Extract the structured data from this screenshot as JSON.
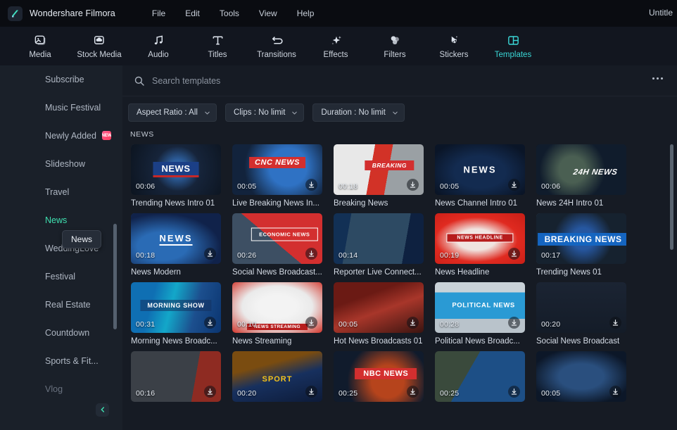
{
  "app": {
    "brand": "Wondershare Filmora",
    "logo_icon": "filmora-logo-icon",
    "document_title": "Untitle",
    "accent_color": "#3ad6d6",
    "active_category_color": "#3fe0b0"
  },
  "menubar": {
    "items": [
      {
        "label": "File",
        "name": "menu-file"
      },
      {
        "label": "Edit",
        "name": "menu-edit"
      },
      {
        "label": "Tools",
        "name": "menu-tools"
      },
      {
        "label": "View",
        "name": "menu-view"
      },
      {
        "label": "Help",
        "name": "menu-help"
      }
    ]
  },
  "tooltabs": {
    "items": [
      {
        "label": "Media",
        "icon": "media-image-icon",
        "active": false
      },
      {
        "label": "Stock Media",
        "icon": "stock-media-cloud-icon",
        "active": false
      },
      {
        "label": "Audio",
        "icon": "audio-note-icon",
        "active": false
      },
      {
        "label": "Titles",
        "icon": "titles-text-icon",
        "active": false
      },
      {
        "label": "Transitions",
        "icon": "transitions-arrow-icon",
        "active": false
      },
      {
        "label": "Effects",
        "icon": "effects-sparkle-icon",
        "active": false
      },
      {
        "label": "Filters",
        "icon": "filters-circles-icon",
        "active": false
      },
      {
        "label": "Stickers",
        "icon": "stickers-cursor-icon",
        "active": false
      },
      {
        "label": "Templates",
        "icon": "templates-layout-icon",
        "active": true
      }
    ]
  },
  "sidebar": {
    "items": [
      {
        "label": "Subscribe",
        "state": "normal",
        "badge": null
      },
      {
        "label": "Music Festival",
        "state": "normal",
        "badge": null
      },
      {
        "label": "Newly Added",
        "state": "normal",
        "badge": "NEW"
      },
      {
        "label": "Slideshow",
        "state": "normal",
        "badge": null
      },
      {
        "label": "Travel",
        "state": "normal",
        "badge": null
      },
      {
        "label": "News",
        "state": "active",
        "badge": null
      },
      {
        "label": "WeddingLove",
        "state": "normal",
        "badge": null
      },
      {
        "label": "Festival",
        "state": "normal",
        "badge": null
      },
      {
        "label": "Real Estate",
        "state": "normal",
        "badge": null
      },
      {
        "label": "Countdown",
        "state": "normal",
        "badge": null
      },
      {
        "label": "Sports & Fit...",
        "state": "normal",
        "badge": null
      },
      {
        "label": "Vlog",
        "state": "dim",
        "badge": null
      }
    ],
    "tooltip": "News",
    "collapse_icon": "chevron-left-icon"
  },
  "search": {
    "placeholder": "Search templates",
    "value": "",
    "icon": "search-icon",
    "more_icon": "more-options-icon"
  },
  "filters": {
    "chips": [
      {
        "label": "Aspect Ratio : All",
        "name": "filter-aspect-ratio"
      },
      {
        "label": "Clips : No limit",
        "name": "filter-clips"
      },
      {
        "label": "Duration : No limit",
        "name": "filter-duration"
      }
    ],
    "chevron_icon": "chevron-down-icon"
  },
  "results": {
    "section_label": "NEWS",
    "download_icon": "download-icon",
    "templates": [
      {
        "title": "Trending News Intro 01",
        "duration": "00:06",
        "art": "a1",
        "overlay": "NEWS",
        "show_dl": false
      },
      {
        "title": "Live Breaking News In...",
        "duration": "00:05",
        "art": "a2",
        "overlay": "CNC NEWS",
        "show_dl": true
      },
      {
        "title": "Breaking News",
        "duration": "00:18",
        "art": "a3",
        "overlay": "BREAKING",
        "show_dl": true
      },
      {
        "title": "News Channel Intro 01",
        "duration": "00:05",
        "art": "a4",
        "overlay": "NEWS",
        "show_dl": true
      },
      {
        "title": "News 24H Intro 01",
        "duration": "00:06",
        "art": "a5",
        "overlay": "24H NEWS",
        "show_dl": false
      },
      {
        "title": "News Modern",
        "duration": "00:18",
        "art": "b1",
        "overlay": "NEWS",
        "show_dl": true
      },
      {
        "title": "Social News Broadcast...",
        "duration": "00:26",
        "art": "b2",
        "overlay": "ECONOMIC NEWS",
        "show_dl": true
      },
      {
        "title": "Reporter Live Connect...",
        "duration": "00:14",
        "art": "b3",
        "overlay": "",
        "show_dl": false
      },
      {
        "title": "News Headline",
        "duration": "00:19",
        "art": "b4",
        "overlay": "NEWS HEADLINE",
        "show_dl": true
      },
      {
        "title": "Trending News 01",
        "duration": "00:17",
        "art": "b5",
        "overlay": "BREAKING NEWS",
        "show_dl": false
      },
      {
        "title": "Morning News Broadc...",
        "duration": "00:31",
        "art": "c1",
        "overlay": "MORNING SHOW",
        "show_dl": true
      },
      {
        "title": "News Streaming",
        "duration": "00:10",
        "art": "c2",
        "overlay": "NEWS STREAMING",
        "show_dl": true
      },
      {
        "title": "Hot News Broadcasts 01",
        "duration": "00:05",
        "art": "c3",
        "overlay": "",
        "show_dl": true
      },
      {
        "title": "Political News Broadc...",
        "duration": "00:28",
        "art": "c4",
        "overlay": "POLITICAL NEWS",
        "show_dl": true
      },
      {
        "title": "Social News Broadcast",
        "duration": "00:20",
        "art": "c5",
        "overlay": "",
        "show_dl": true
      },
      {
        "title": "",
        "duration": "00:16",
        "art": "d1",
        "overlay": "",
        "show_dl": true
      },
      {
        "title": "",
        "duration": "00:20",
        "art": "d2",
        "overlay": "SPORT",
        "show_dl": true
      },
      {
        "title": "",
        "duration": "00:25",
        "art": "d3",
        "overlay": "NBC NEWS",
        "show_dl": true
      },
      {
        "title": "",
        "duration": "00:25",
        "art": "d4",
        "overlay": "",
        "show_dl": true
      },
      {
        "title": "",
        "duration": "00:05",
        "art": "d5",
        "overlay": "",
        "show_dl": true
      }
    ]
  }
}
